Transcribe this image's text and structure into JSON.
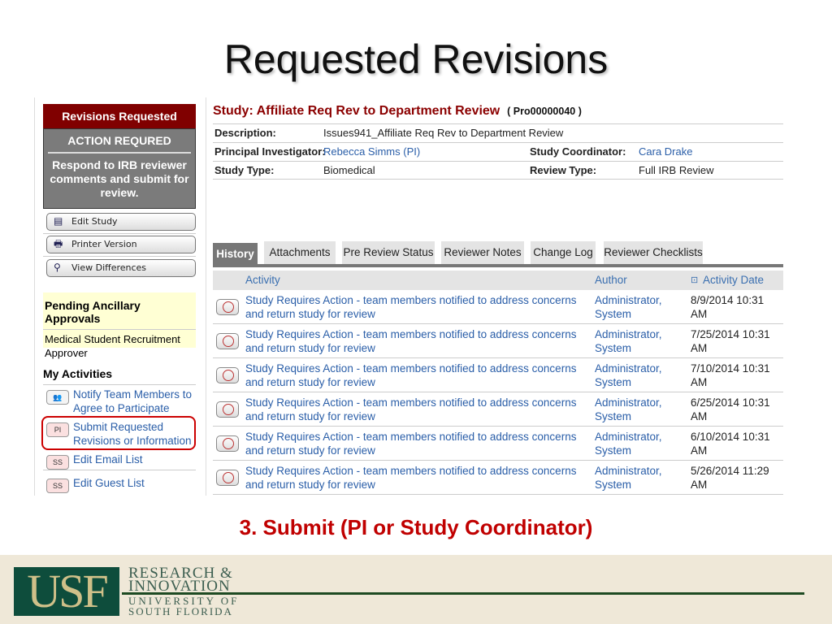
{
  "slide": {
    "title": "Requested Revisions",
    "caption": "3. Submit (PI or Study Coordinator)"
  },
  "left": {
    "status_header": "Revisions Requested",
    "action_title": "ACTION REQURED",
    "action_text": "Respond to IRB reviewer comments and submit for review.",
    "buttons": [
      "Edit Study",
      "Printer Version",
      "View Differences"
    ],
    "pending": {
      "title": "Pending Ancillary Approvals",
      "item": "Medical Student Recruitment Approver"
    },
    "activities_title": "My Activities",
    "activities": [
      {
        "badge": "",
        "label": "Notify Team Members to Agree to Participate"
      },
      {
        "badge": "PI",
        "label": "Submit Requested Revisions or Information"
      },
      {
        "badge": "SS",
        "label": "Edit Email List"
      },
      {
        "badge": "SS",
        "label": "Edit Guest List"
      }
    ]
  },
  "study": {
    "title": "Study: Affiliate Req Rev to Department Review",
    "id": "( Pro00000040 )",
    "description_label": "Description:",
    "description": "Issues941_Affiliate Req Rev to Department Review",
    "pi_label": "Principal Investigator:",
    "pi": "Rebecca Simms (PI)",
    "sc_label": "Study Coordinator:",
    "sc": "Cara Drake",
    "type_label": "Study Type:",
    "type": "Biomedical",
    "review_label": "Review Type:",
    "review": "Full IRB Review"
  },
  "tabs": [
    "History",
    "Attachments",
    "Pre Review Status",
    "Reviewer Notes",
    "Change Log",
    "Reviewer Checklists"
  ],
  "history": {
    "columns": [
      "Activity",
      "Author",
      "Activity Date"
    ],
    "rows": [
      {
        "activity": "Study Requires Action - team members notified to address concerns and return study for review",
        "author": "Administrator, System",
        "date": "8/9/2014 10:31 AM"
      },
      {
        "activity": "Study Requires Action - team members notified to address concerns and return study for review",
        "author": "Administrator, System",
        "date": "7/25/2014 10:31 AM"
      },
      {
        "activity": "Study Requires Action - team members notified to address concerns and return study for review",
        "author": "Administrator, System",
        "date": "7/10/2014 10:31 AM"
      },
      {
        "activity": "Study Requires Action - team members notified to address concerns and return study for review",
        "author": "Administrator, System",
        "date": "6/25/2014 10:31 AM"
      },
      {
        "activity": "Study Requires Action - team members notified to address concerns and return study for review",
        "author": "Administrator, System",
        "date": "6/10/2014 10:31 AM"
      },
      {
        "activity": "Study Requires Action - team members notified to address concerns and return study for review",
        "author": "Administrator, System",
        "date": "5/26/2014 11:29 AM"
      }
    ]
  },
  "footer": {
    "logo": "USF",
    "line1": "RESEARCH &",
    "line2": "INNOVATION",
    "line3": "UNIVERSITY OF",
    "line4": "SOUTH FLORIDA"
  }
}
